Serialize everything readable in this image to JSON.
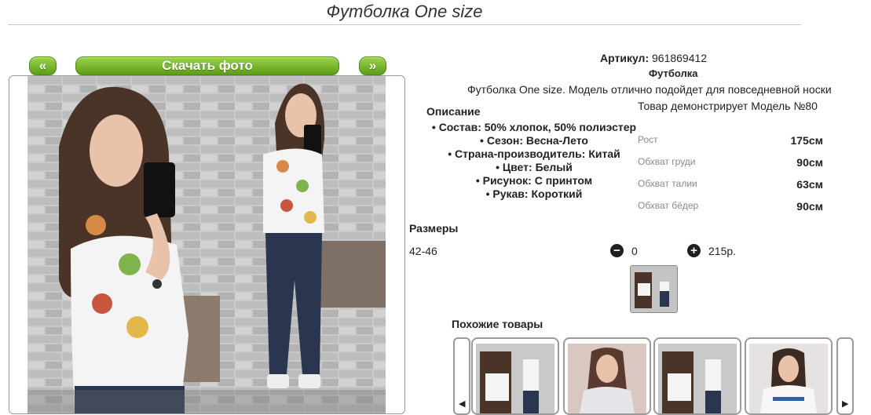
{
  "page_title": "Футболка One size",
  "nav": {
    "prev": "«",
    "download": "Скачать фото",
    "next": "»"
  },
  "product": {
    "article_label": "Артикул:",
    "article_value": " 961869412",
    "name": "Футболка",
    "description": "Футболка One size. Модель отлично подойдет для повседневной носки",
    "model_note": "Товар демонстрирует Модель №80",
    "description_heading": "Описание",
    "specs": [
      "Состав: 50% хлопок, 50% полиэстер",
      "Сезон: Весна-Лето",
      "Страна-производитель: Китай",
      "Цвет: Белый",
      "Рисунок: С принтом",
      "Рукав: Короткий"
    ]
  },
  "measurements": [
    {
      "label": "Рост",
      "value": "175см"
    },
    {
      "label": "Обхват груди",
      "value": "90см"
    },
    {
      "label": "Обхват талии",
      "value": "63см"
    },
    {
      "label": "Обхват бёдер",
      "value": "90см"
    }
  ],
  "sizes": {
    "heading": "Размеры",
    "size": "42-46",
    "minus": "−",
    "quantity": "0",
    "plus": "+",
    "price": "215р."
  },
  "similar": {
    "heading": "Похожие товары",
    "prev_arrow": "◀",
    "next_arrow": "▶"
  },
  "icons": {
    "prev": "chevron-left-icon",
    "next": "chevron-right-icon",
    "minus": "minus-circle-icon",
    "plus": "plus-circle-icon"
  },
  "colors": {
    "accent_green": "#6aad1f",
    "jeans": "#2a3550",
    "wall": "#b5b5b5"
  }
}
